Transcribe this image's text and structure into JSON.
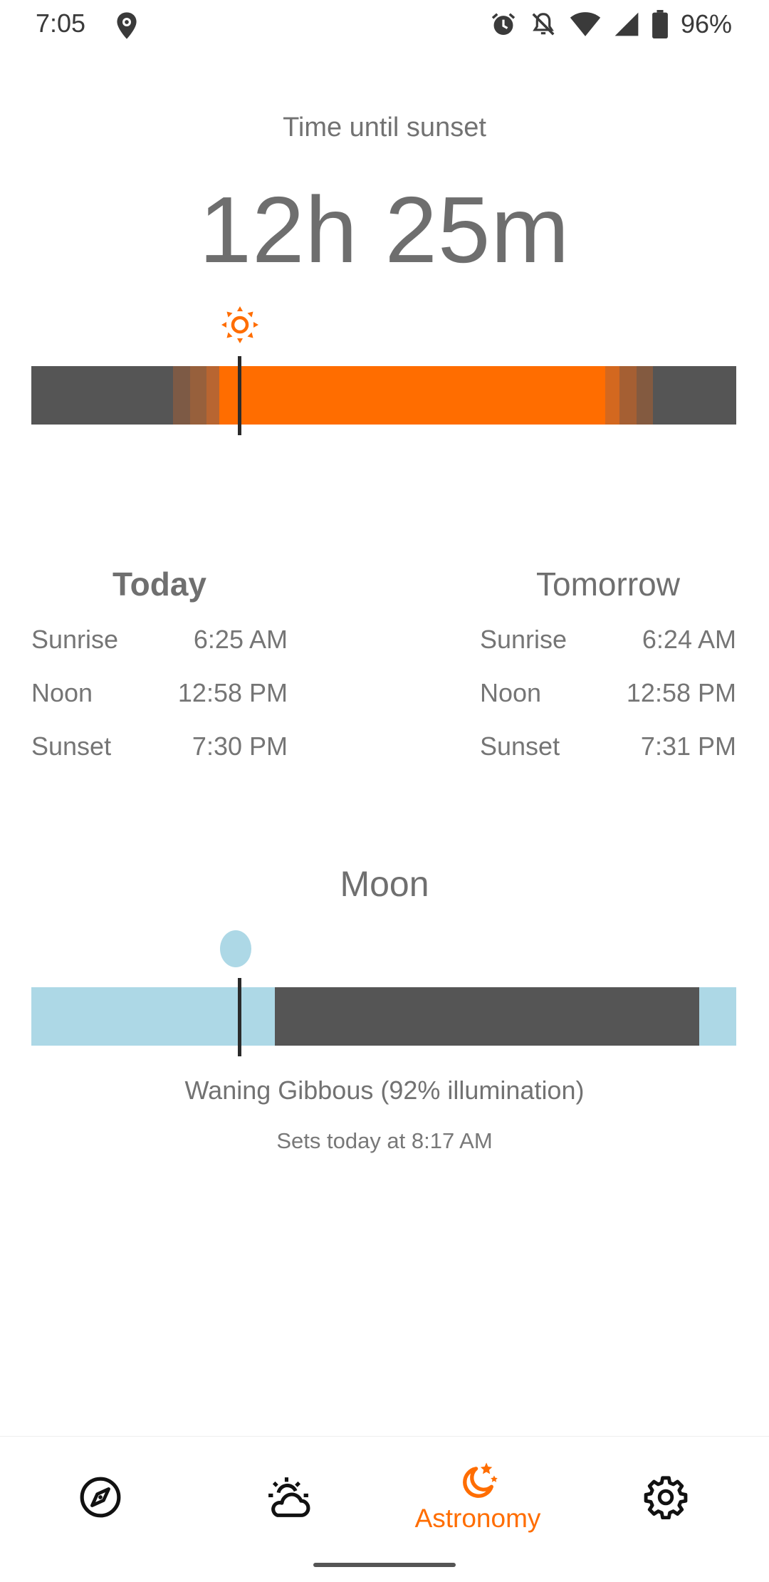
{
  "status_bar": {
    "time": "7:05",
    "battery": "96%",
    "icons": [
      "location-pin-icon",
      "alarm-icon",
      "notifications-off-icon",
      "wifi-icon",
      "cell-signal-icon",
      "battery-icon"
    ]
  },
  "sun": {
    "label": "Time until sunset",
    "countdown": "12h 25m",
    "icon": "sun-icon",
    "color": "#ff6d00"
  },
  "today": {
    "heading": "Today",
    "rows": [
      {
        "label": "Sunrise",
        "value": "6:25 AM"
      },
      {
        "label": "Noon",
        "value": "12:58 PM"
      },
      {
        "label": "Sunset",
        "value": "7:30 PM"
      }
    ]
  },
  "tomorrow": {
    "heading": "Tomorrow",
    "rows": [
      {
        "label": "Sunrise",
        "value": "6:24 AM"
      },
      {
        "label": "Noon",
        "value": "12:58 PM"
      },
      {
        "label": "Sunset",
        "value": "7:31 PM"
      }
    ]
  },
  "moon": {
    "heading": "Moon",
    "phase": "Waning Gibbous (92% illumination)",
    "set_text": "Sets today at 8:17 AM",
    "color": "#add8e6"
  },
  "bottom_nav": {
    "items": [
      {
        "icon": "compass-icon",
        "label": ""
      },
      {
        "icon": "weather-sun-cloud-icon",
        "label": ""
      },
      {
        "icon": "moon-stars-icon",
        "label": "Astronomy",
        "selected": true
      },
      {
        "icon": "gear-icon",
        "label": ""
      }
    ],
    "accent": "#ff6d00"
  }
}
